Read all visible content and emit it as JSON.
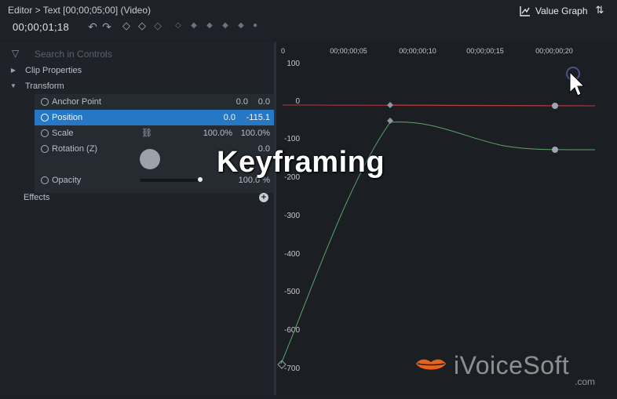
{
  "header": {
    "title": "Editor > Text [00;00;05;00] (Video)",
    "timecode": "00;00;01;18",
    "value_graph_label": "Value Graph"
  },
  "search": {
    "placeholder": "Search in Controls"
  },
  "tree": {
    "clip_properties": "Clip Properties",
    "transform": "Transform",
    "effects": "Effects"
  },
  "params": [
    {
      "name": "Anchor Point",
      "v1": "0.0",
      "v2": "0.0"
    },
    {
      "name": "Position",
      "v1": "0.0",
      "v2": "-115.1"
    },
    {
      "name": "Scale",
      "v1": "100.0%",
      "v2": "100.0%"
    },
    {
      "name": "Rotation (Z)",
      "v1": "",
      "v2": "0.0"
    },
    {
      "name": "Opacity",
      "v1": "",
      "v2": "100.0 %"
    }
  ],
  "graph": {
    "time_labels": [
      "0",
      "00;00;00;05",
      "00;00;00;10",
      "00;00;00;15",
      "00;00;00;20"
    ],
    "value_labels": [
      "100",
      "0",
      "-100",
      "-200",
      "-300",
      "-400",
      "-500",
      "-600",
      "-700"
    ],
    "curve_color": "#5da36b",
    "ref_line_color": "#b83a3a"
  },
  "overlay": {
    "title": "Keyframing",
    "watermark": "iVoiceSoft",
    "watermark_suffix": ".com",
    "accent": "#e8621c"
  }
}
